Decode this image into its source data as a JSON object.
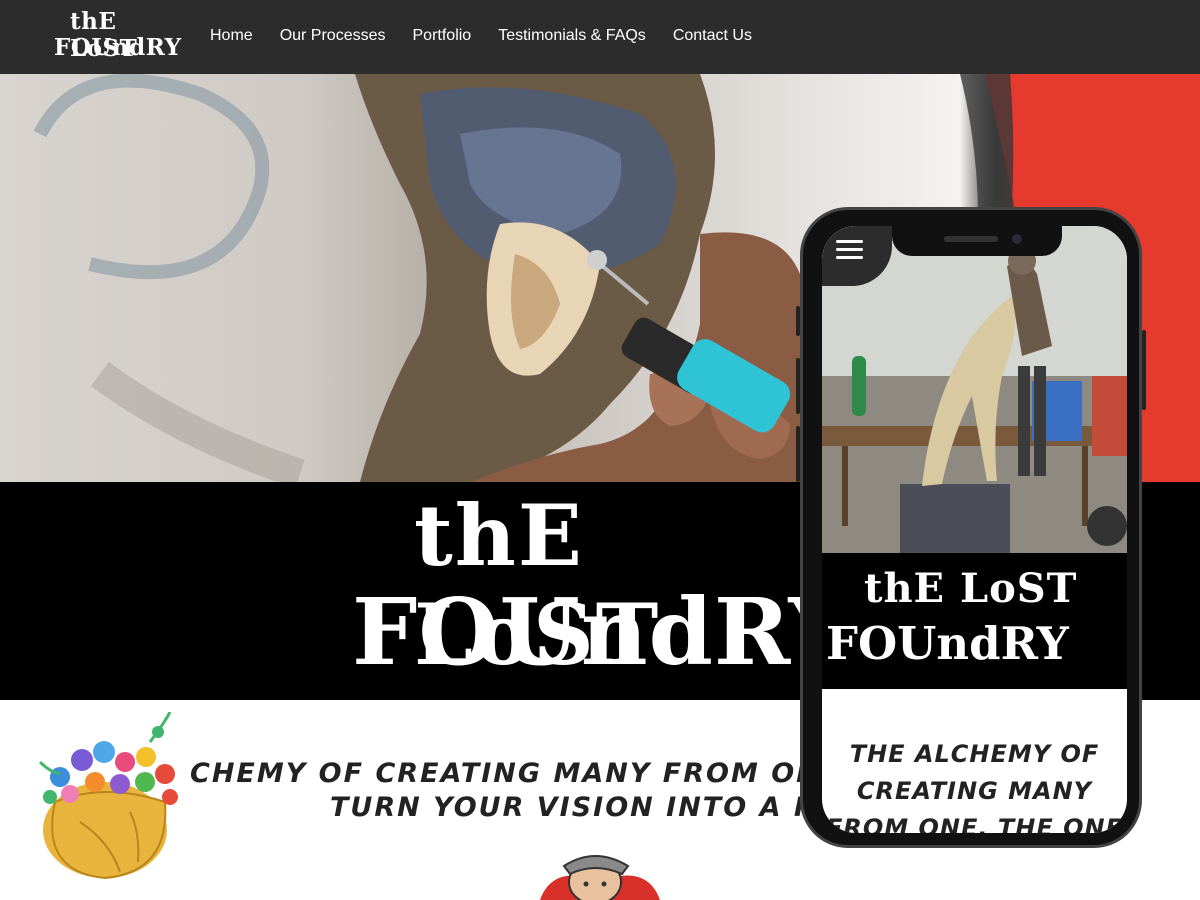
{
  "nav": {
    "logo_line1": "thE LoST",
    "logo_line2": "FOUndRY",
    "links": [
      "Home",
      "Our Processes",
      "Portfolio",
      "Testimonials & FAQs",
      "Contact Us"
    ]
  },
  "hero": {
    "logo_line1": "thE LoST",
    "logo_line2": "FOUndRY"
  },
  "tagline": {
    "line1": "CHEMY OF CREATING MANY FROM ONE, T",
    "line2": "TURN YOUR VISION INTO A REAL"
  },
  "phone": {
    "logo_line1": "thE LoST",
    "logo_line2": "FOUndRY",
    "tagline": "THE ALCHEMY OF CREATING MANY FROM ONE, THE ONE"
  },
  "colors": {
    "nav_bg": "#2c2c2c",
    "banner_bg": "#000000",
    "accent_red": "#e53a2d",
    "pot_gold": "#e9b43c"
  },
  "icons": [
    "hamburger-menu-icon",
    "flower-pot-illustration",
    "mascot-illustration"
  ]
}
